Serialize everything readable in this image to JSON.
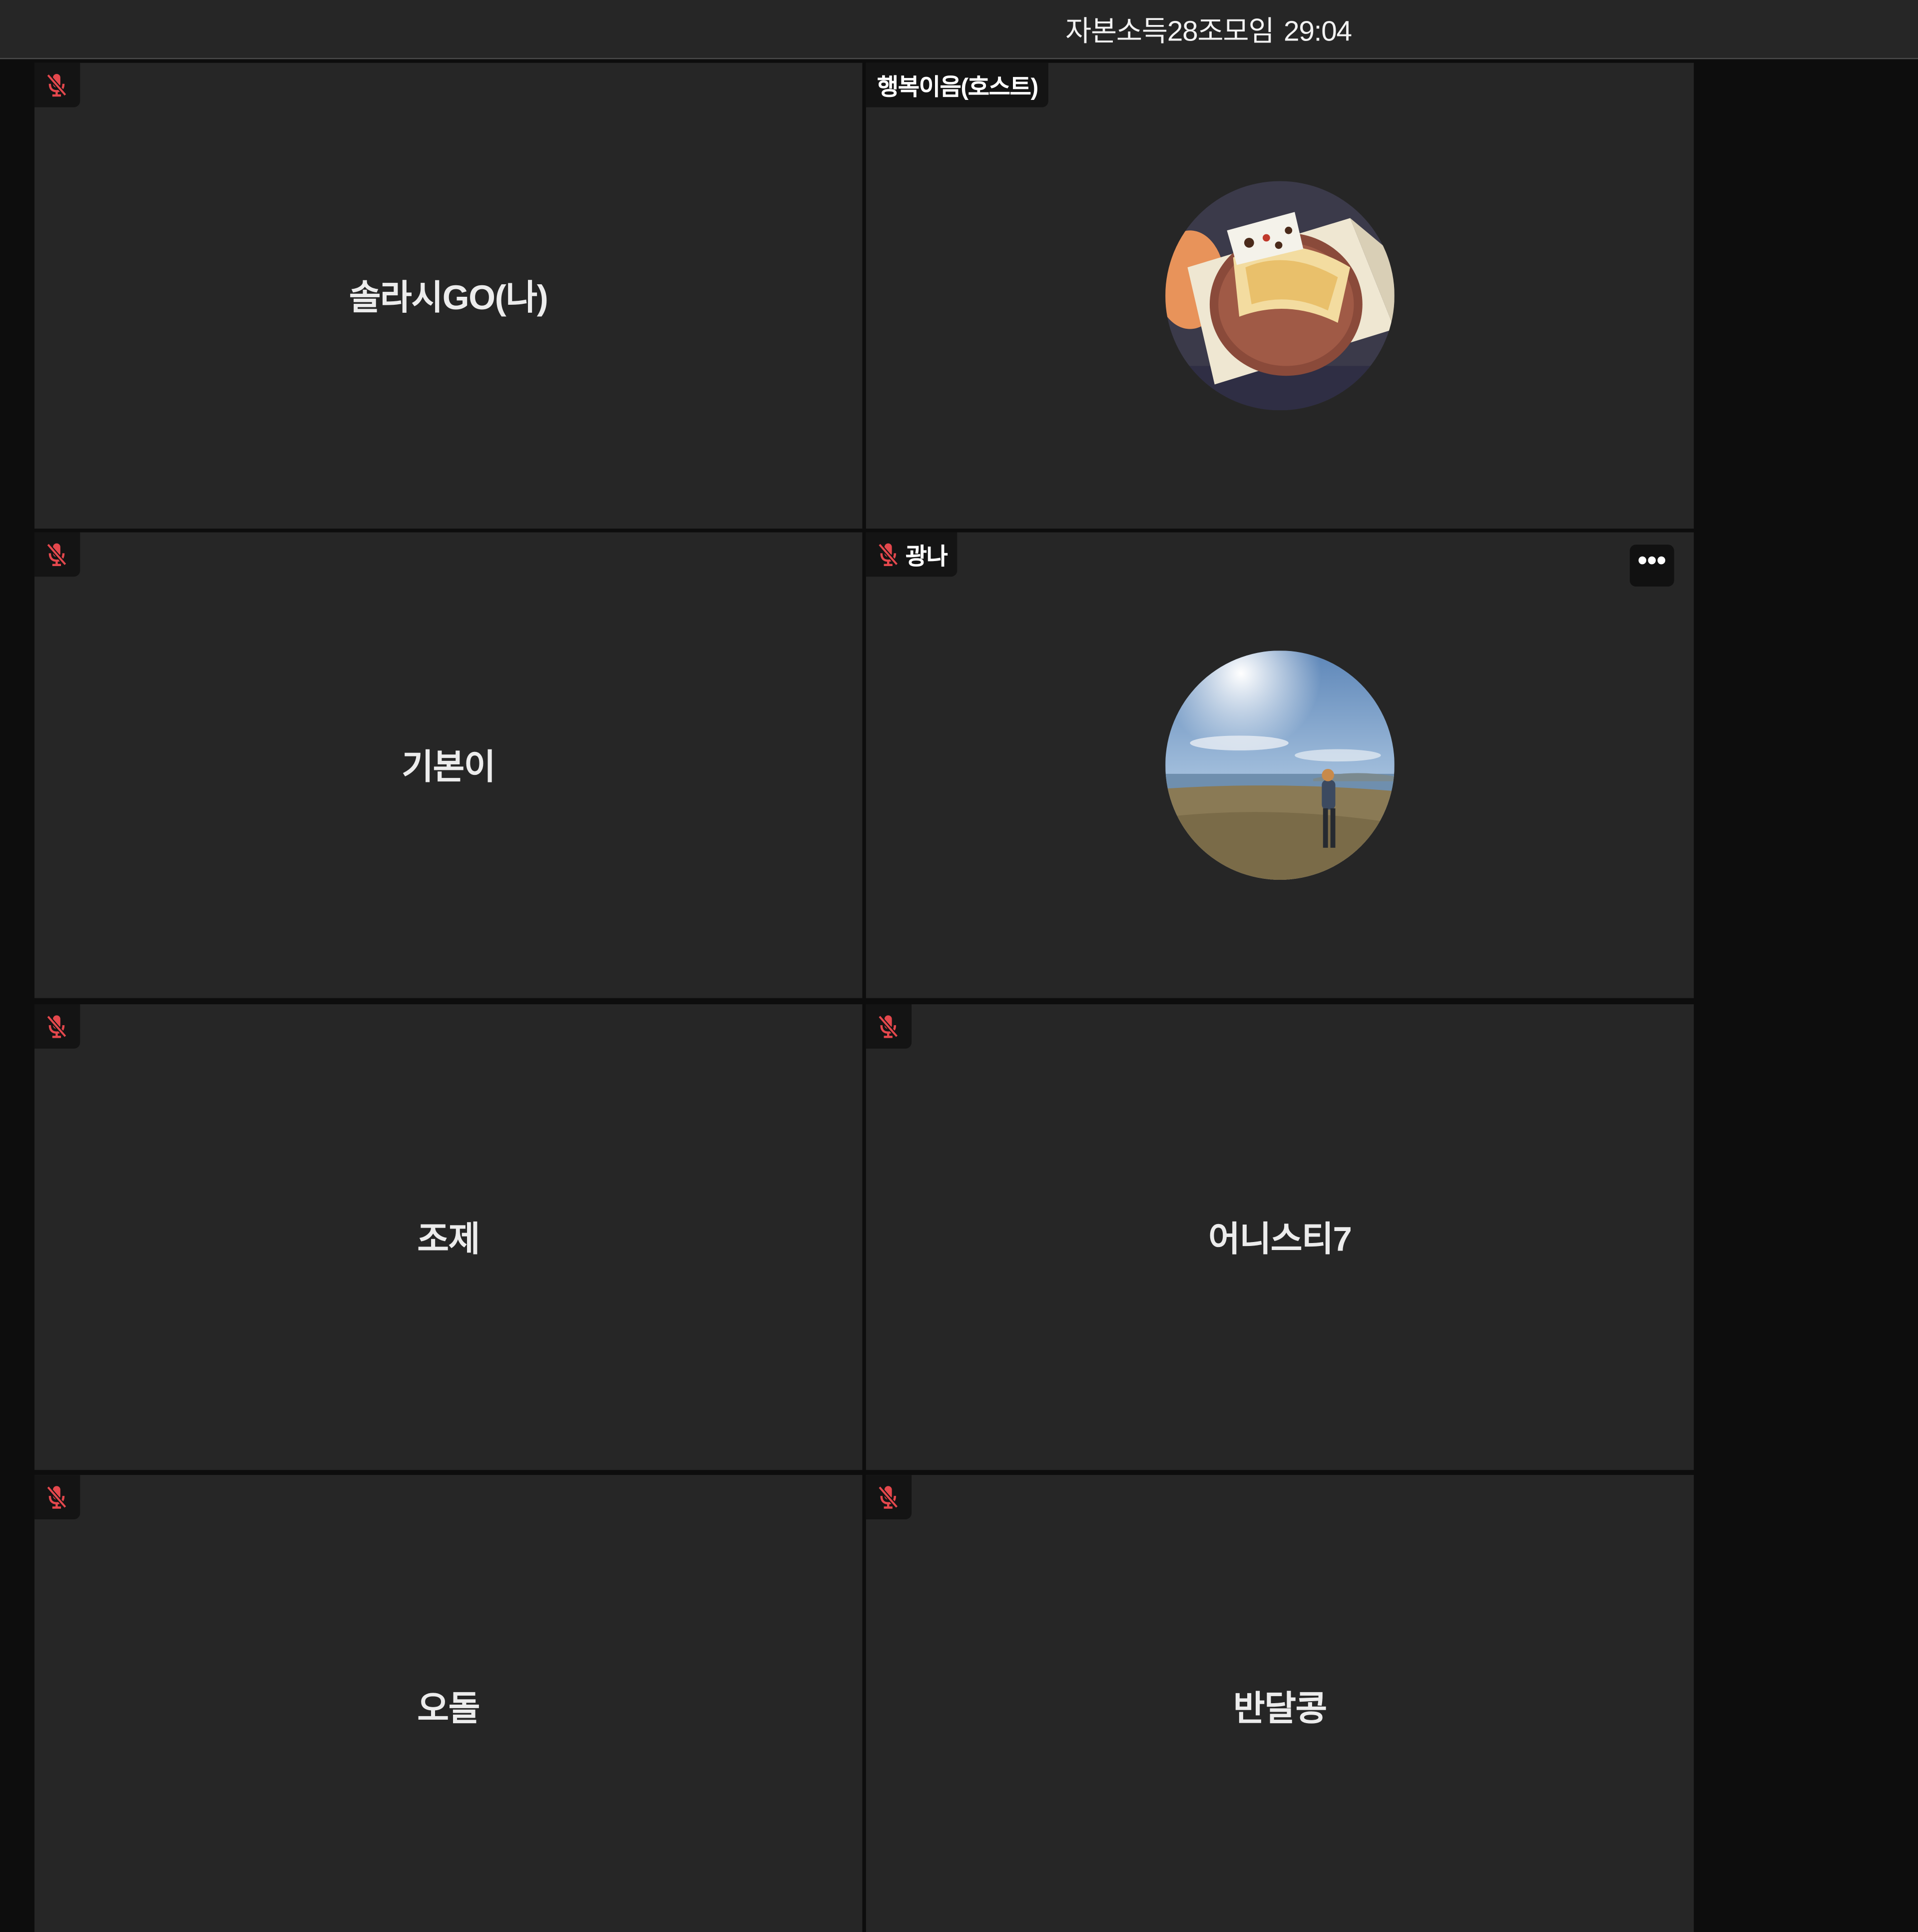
{
  "meeting": {
    "title": "자본소득28조모임",
    "elapsed_time": "29:04"
  },
  "colors": {
    "tile_background": "#262626",
    "page_background": "#0d0d0d",
    "mic_muted": "#e5484d"
  },
  "participants": [
    {
      "name": "솔라시GO(나)",
      "tag_label": "",
      "mic_muted": true,
      "video": "name-only"
    },
    {
      "name": "행복이음(호스트)",
      "tag_label": "행복이음(호스트)",
      "mic_muted": false,
      "video": "avatar-cake-photo"
    },
    {
      "name": "기본이",
      "tag_label": "",
      "mic_muted": true,
      "video": "name-only"
    },
    {
      "name": "광나",
      "tag_label": "광나",
      "mic_muted": true,
      "video": "avatar-field-photo",
      "more_options_icon": "ellipsis-icon"
    },
    {
      "name": "조제",
      "tag_label": "",
      "mic_muted": true,
      "video": "name-only"
    },
    {
      "name": "어니스티7",
      "tag_label": "",
      "mic_muted": true,
      "video": "name-only"
    },
    {
      "name": "오돌",
      "tag_label": "",
      "mic_muted": true,
      "video": "name-only"
    },
    {
      "name": "반달콩",
      "tag_label": "",
      "mic_muted": true,
      "video": "name-only"
    }
  ],
  "more_button_label": "•••"
}
